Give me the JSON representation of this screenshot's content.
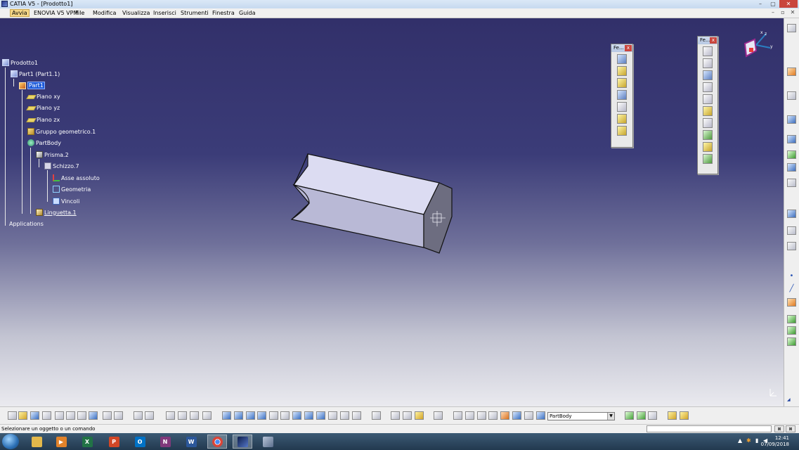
{
  "window": {
    "title": "CATIA V5 - [Prodotto1]",
    "controls": [
      "–",
      "▢",
      "✕"
    ]
  },
  "menu": {
    "items": [
      "Avvia",
      "ENOVIA V5 VPM",
      "File",
      "Modifica",
      "Visualizza",
      "Inserisci",
      "Strumenti",
      "Finestra",
      "Guida"
    ],
    "mdi_controls": [
      "–",
      "▫",
      "✕"
    ]
  },
  "tree": {
    "root": "Prodotto1",
    "part_instance": "Part1 (Part1.1)",
    "part": "Part1",
    "plane_xy": "Piano xy",
    "plane_yz": "Piano yz",
    "plane_zx": "Piano zx",
    "geo_set": "Gruppo geometrico.1",
    "body": "PartBody",
    "pad": "Prisma.2",
    "sketch": "Schizzo.7",
    "abs_axis": "Asse assoluto",
    "geometry": "Geometria",
    "constraints": "Vincoli",
    "tab": "Linguetta.1",
    "applications": "Applications"
  },
  "toolbars": {
    "features_title_1": "Fe...",
    "features_title_2": "Fe..."
  },
  "bottom": {
    "current_body": "PartBody"
  },
  "status": {
    "message": "Selezionare un oggetto o un comando"
  },
  "taskbar": {
    "time": "12:41",
    "date": "07/09/2018",
    "apps": [
      "start",
      "explorer",
      "media-player",
      "excel",
      "powerpoint",
      "outlook",
      "onenote",
      "word",
      "chrome",
      "catia",
      "catia-launcher"
    ]
  },
  "colors": {
    "viewport_top": "#32306a",
    "viewport_bottom": "#eaeaef",
    "selection": "#1e5bd8",
    "part_face_light": "#dcdcf2",
    "part_face_mid": "#b9b9d6",
    "part_face_dark": "#6d6d80"
  }
}
